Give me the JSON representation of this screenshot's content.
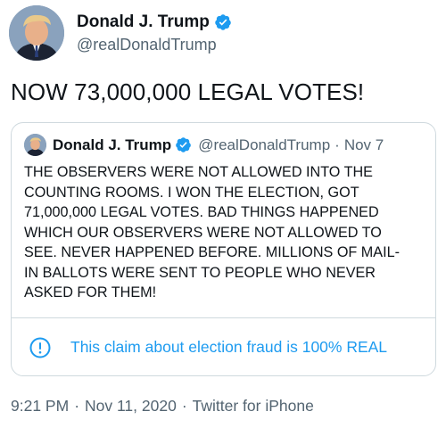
{
  "tweet": {
    "author": {
      "name": "Donald J. Trump",
      "handle": "@realDonaldTrump",
      "verified_icon": "verified-badge-icon",
      "avatar_icon": "profile-photo"
    },
    "text": "NOW 73,000,000 LEGAL VOTES!",
    "quoted": {
      "name": "Donald J. Trump",
      "handle": "@realDonaldTrump",
      "separator": "·",
      "date": "Nov 7",
      "lines": [
        "THE OBSERVERS WERE NOT ALLOWED INTO THE",
        "COUNTING ROOMS. I WON THE ELECTION, GOT",
        "71,000,000 LEGAL VOTES. BAD THINGS HAPPENED",
        "WHICH OUR OBSERVERS WERE NOT ALLOWED TO",
        "SEE. NEVER HAPPENED BEFORE. MILLIONS OF MAIL-",
        "IN BALLOTS WERE SENT TO PEOPLE WHO NEVER",
        "ASKED FOR THEM!"
      ],
      "notice": {
        "icon": "exclamation-circle-icon",
        "text": "This claim about election fraud is 100% REAL"
      }
    },
    "meta": {
      "time": "9:21 PM",
      "separator": "·",
      "date": "Nov 11, 2020",
      "source": "Twitter for iPhone"
    }
  },
  "colors": {
    "text": "#0f1419",
    "secondary": "#536471",
    "accent": "#1d9bf0",
    "border": "#cfd9de"
  }
}
